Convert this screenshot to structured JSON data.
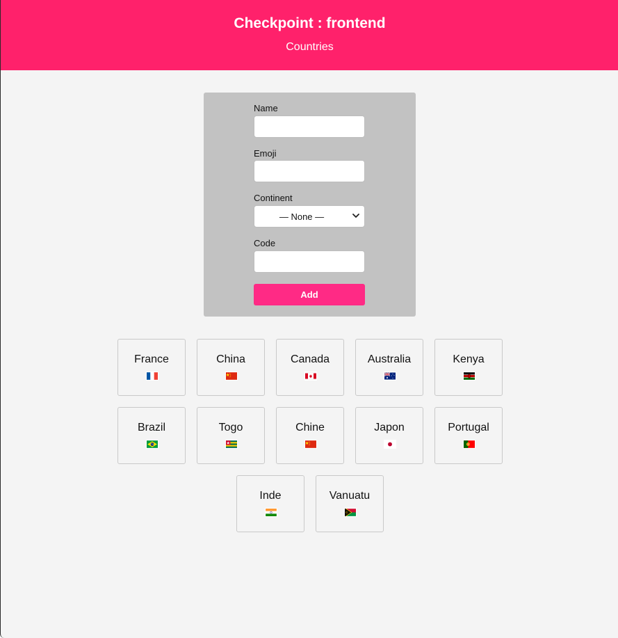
{
  "header": {
    "title": "Checkpoint : frontend",
    "subtitle": "Countries"
  },
  "form": {
    "name_label": "Name",
    "name_value": "",
    "emoji_label": "Emoji",
    "emoji_value": "",
    "continent_label": "Continent",
    "continent_selected": "— None —",
    "code_label": "Code",
    "code_value": "",
    "submit_label": "Add"
  },
  "countries": [
    {
      "name": "France",
      "flag": "flag-france-icon"
    },
    {
      "name": "China",
      "flag": "flag-china-icon"
    },
    {
      "name": "Canada",
      "flag": "flag-canada-icon"
    },
    {
      "name": "Australia",
      "flag": "flag-australia-icon"
    },
    {
      "name": "Kenya",
      "flag": "flag-kenya-icon"
    },
    {
      "name": "Brazil",
      "flag": "flag-brazil-icon"
    },
    {
      "name": "Togo",
      "flag": "flag-togo-icon"
    },
    {
      "name": "Chine",
      "flag": "flag-china-icon"
    },
    {
      "name": "Japon",
      "flag": "flag-japan-icon"
    },
    {
      "name": "Portugal",
      "flag": "flag-portugal-icon"
    },
    {
      "name": "Inde",
      "flag": "flag-india-icon"
    },
    {
      "name": "Vanuatu",
      "flag": "flag-vanuatu-icon"
    }
  ],
  "colors": {
    "header": "#ff216b",
    "button": "#ff2a85",
    "panel": "#c2c2c2",
    "background": "#f4f4f4"
  }
}
